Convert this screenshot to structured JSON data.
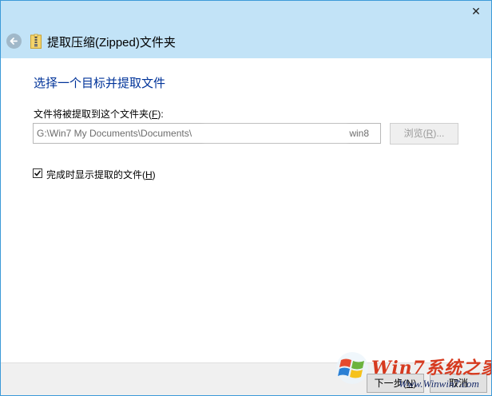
{
  "titlebar": {
    "close_glyph": "✕"
  },
  "header": {
    "back_icon": "back-arrow-icon",
    "folder_icon": "zip-folder-icon",
    "title": "提取压缩(Zipped)文件夹"
  },
  "main": {
    "heading": "选择一个目标并提取文件",
    "folder_label_pre": "文件将被提取到这个文件夹(",
    "folder_label_key": "F",
    "folder_label_post": "):",
    "path_value_start": "G:\\Win7 My Documents\\Documents\\",
    "path_value_end": "win8",
    "browse_label_pre": "浏览(",
    "browse_label_key": "R",
    "browse_label_post": ")...",
    "show_files_checked": true,
    "show_files_label_pre": "完成时显示提取的文件(",
    "show_files_label_key": "H",
    "show_files_label_post": ")"
  },
  "footer": {
    "next_label_pre": "下一步(",
    "next_label_key": "N",
    "next_label_post": ")",
    "cancel_label": "取消"
  },
  "watermark": {
    "brand": "Win7系统之家",
    "url": "Www.Winwin7.com"
  },
  "colors": {
    "header_bg": "#c2e3f7",
    "heading_blue": "#003399",
    "window_border": "#3c9ad8"
  }
}
